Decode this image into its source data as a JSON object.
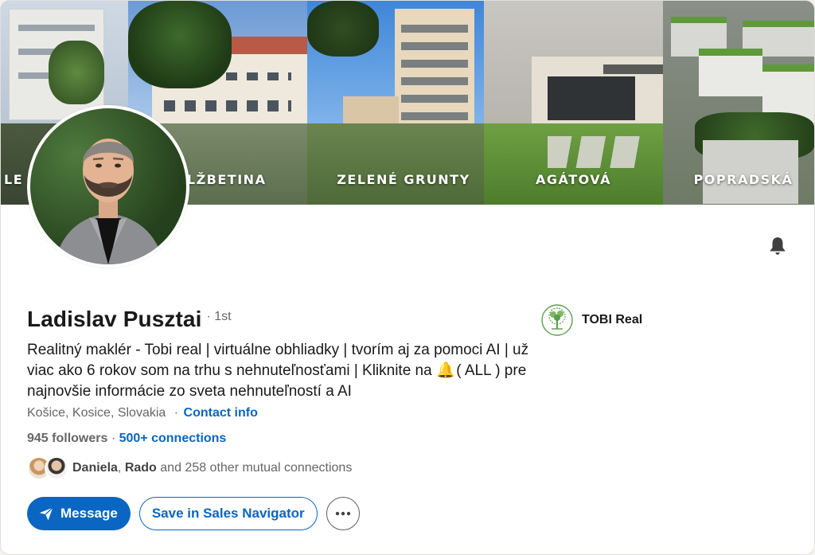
{
  "banner": {
    "panels": [
      {
        "label": "LE"
      },
      {
        "label": "ALŽBETINA"
      },
      {
        "label": "ZELENÉ GRUNTY"
      },
      {
        "label": "AGÁTOVÁ"
      },
      {
        "label": "POPRADSKÁ"
      }
    ]
  },
  "profile": {
    "name": "Ladislav Pusztai",
    "degree": "· 1st",
    "headline_part1": "Realitný maklér - Tobi real | virtuálne obhliadky | tvorím aj za pomoci AI | už viac ako 6 rokov som na trhu s nehnuteľnosťami | Kliknite na ",
    "headline_emoji": "🔔",
    "headline_part2": " ( ALL ) pre najnovšie informácie zo sveta nehnuteľností a AI",
    "location": "Košice, Kosice, Slovakia",
    "location_separator": "·",
    "contact_info_label": "Contact info",
    "followers": "945 followers",
    "followers_separator": "·",
    "connections": "500+ connections",
    "mutual": {
      "name1": "Daniela",
      "separator": ",",
      "name2": "Rado",
      "rest": " and 258 other mutual connections"
    }
  },
  "company": {
    "name": "TOBI Real"
  },
  "actions": {
    "message_label": "Message",
    "sales_nav_label": "Save in Sales Navigator"
  },
  "icons": {
    "bell": "bell-icon",
    "send": "send-icon",
    "more": "more-icon",
    "company_logo": "tree-logo-icon"
  },
  "colors": {
    "accent": "#0a66c2",
    "text_primary": "#191919",
    "text_secondary": "#666666",
    "logo_green": "#5a9e4b"
  }
}
